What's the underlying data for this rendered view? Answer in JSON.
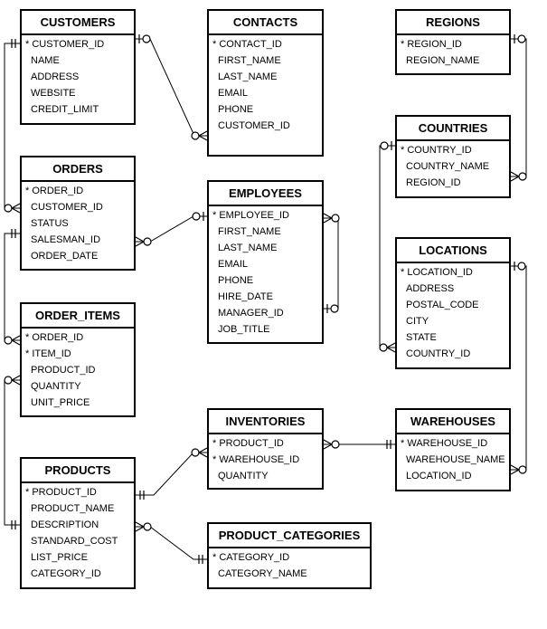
{
  "tables": [
    {
      "key": "customers",
      "name": "CUSTOMERS",
      "columns": [
        {
          "name": "CUSTOMER_ID",
          "pk": true
        },
        {
          "name": "NAME"
        },
        {
          "name": "ADDRESS"
        },
        {
          "name": "WEBSITE"
        },
        {
          "name": "CREDIT_LIMIT"
        }
      ]
    },
    {
      "key": "contacts",
      "name": "CONTACTS",
      "columns": [
        {
          "name": "CONTACT_ID",
          "pk": true
        },
        {
          "name": "FIRST_NAME"
        },
        {
          "name": "LAST_NAME"
        },
        {
          "name": "EMAIL"
        },
        {
          "name": "PHONE"
        },
        {
          "name": "CUSTOMER_ID"
        }
      ]
    },
    {
      "key": "regions",
      "name": "REGIONS",
      "columns": [
        {
          "name": "REGION_ID",
          "pk": true
        },
        {
          "name": "REGION_NAME"
        }
      ]
    },
    {
      "key": "countries",
      "name": "COUNTRIES",
      "columns": [
        {
          "name": "COUNTRY_ID",
          "pk": true
        },
        {
          "name": "COUNTRY_NAME"
        },
        {
          "name": "REGION_ID"
        }
      ]
    },
    {
      "key": "orders",
      "name": "ORDERS",
      "columns": [
        {
          "name": "ORDER_ID",
          "pk": true
        },
        {
          "name": "CUSTOMER_ID"
        },
        {
          "name": "STATUS"
        },
        {
          "name": "SALESMAN_ID"
        },
        {
          "name": "ORDER_DATE"
        }
      ]
    },
    {
      "key": "employees",
      "name": "EMPLOYEES",
      "columns": [
        {
          "name": "EMPLOYEE_ID",
          "pk": true
        },
        {
          "name": "FIRST_NAME"
        },
        {
          "name": "LAST_NAME"
        },
        {
          "name": "EMAIL"
        },
        {
          "name": "PHONE"
        },
        {
          "name": "HIRE_DATE"
        },
        {
          "name": "MANAGER_ID"
        },
        {
          "name": "JOB_TITLE"
        }
      ]
    },
    {
      "key": "locations",
      "name": "LOCATIONS",
      "columns": [
        {
          "name": "LOCATION_ID",
          "pk": true
        },
        {
          "name": "ADDRESS"
        },
        {
          "name": "POSTAL_CODE"
        },
        {
          "name": "CITY"
        },
        {
          "name": "STATE"
        },
        {
          "name": "COUNTRY_ID"
        }
      ]
    },
    {
      "key": "order_items",
      "name": "ORDER_ITEMS",
      "columns": [
        {
          "name": "ORDER_ID",
          "pk": true
        },
        {
          "name": "ITEM_ID",
          "pk": true
        },
        {
          "name": "PRODUCT_ID"
        },
        {
          "name": "QUANTITY"
        },
        {
          "name": "UNIT_PRICE"
        }
      ]
    },
    {
      "key": "inventories",
      "name": "INVENTORIES",
      "columns": [
        {
          "name": "PRODUCT_ID",
          "pk": true
        },
        {
          "name": "WAREHOUSE_ID",
          "pk": true
        },
        {
          "name": "QUANTITY"
        }
      ]
    },
    {
      "key": "warehouses",
      "name": "WAREHOUSES",
      "columns": [
        {
          "name": "WAREHOUSE_ID",
          "pk": true
        },
        {
          "name": "WAREHOUSE_NAME"
        },
        {
          "name": "LOCATION_ID"
        }
      ]
    },
    {
      "key": "products",
      "name": "PRODUCTS",
      "columns": [
        {
          "name": "PRODUCT_ID",
          "pk": true
        },
        {
          "name": "PRODUCT_NAME"
        },
        {
          "name": "DESCRIPTION"
        },
        {
          "name": "STANDARD_COST"
        },
        {
          "name": "LIST_PRICE"
        },
        {
          "name": "CATEGORY_ID"
        }
      ]
    },
    {
      "key": "product_categories",
      "name": "PRODUCT_CATEGORIES",
      "columns": [
        {
          "name": "CATEGORY_ID",
          "pk": true
        },
        {
          "name": "CATEGORY_NAME"
        }
      ]
    }
  ],
  "pk_marker": "*",
  "relationships": [
    {
      "parent": "CUSTOMERS",
      "child": "CONTACTS",
      "parent_end": "zero-or-one",
      "child_end": "zero-or-many"
    },
    {
      "parent": "CUSTOMERS",
      "child": "ORDERS",
      "parent_end": "one-and-only-one",
      "child_end": "zero-or-many"
    },
    {
      "parent": "EMPLOYEES",
      "child": "ORDERS",
      "parent_end": "zero-or-one",
      "child_end": "zero-or-many"
    },
    {
      "parent": "EMPLOYEES",
      "child": "EMPLOYEES",
      "parent_end": "zero-or-one",
      "child_end": "zero-or-many"
    },
    {
      "parent": "ORDERS",
      "child": "ORDER_ITEMS",
      "parent_end": "one-and-only-one",
      "child_end": "zero-or-many"
    },
    {
      "parent": "PRODUCTS",
      "child": "ORDER_ITEMS",
      "parent_end": "one-and-only-one",
      "child_end": "zero-or-many"
    },
    {
      "parent": "PRODUCTS",
      "child": "INVENTORIES",
      "parent_end": "one-and-only-one",
      "child_end": "zero-or-many"
    },
    {
      "parent": "PRODUCT_CATEGORIES",
      "child": "PRODUCTS",
      "parent_end": "one-and-only-one",
      "child_end": "zero-or-many"
    },
    {
      "parent": "WAREHOUSES",
      "child": "INVENTORIES",
      "parent_end": "one-and-only-one",
      "child_end": "zero-or-many"
    },
    {
      "parent": "REGIONS",
      "child": "COUNTRIES",
      "parent_end": "zero-or-one",
      "child_end": "zero-or-many"
    },
    {
      "parent": "COUNTRIES",
      "child": "LOCATIONS",
      "parent_end": "zero-or-one",
      "child_end": "zero-or-many"
    },
    {
      "parent": "LOCATIONS",
      "child": "WAREHOUSES",
      "parent_end": "zero-or-one",
      "child_end": "zero-or-many"
    }
  ],
  "colors": {
    "line": "#000000",
    "background": "#ffffff"
  }
}
